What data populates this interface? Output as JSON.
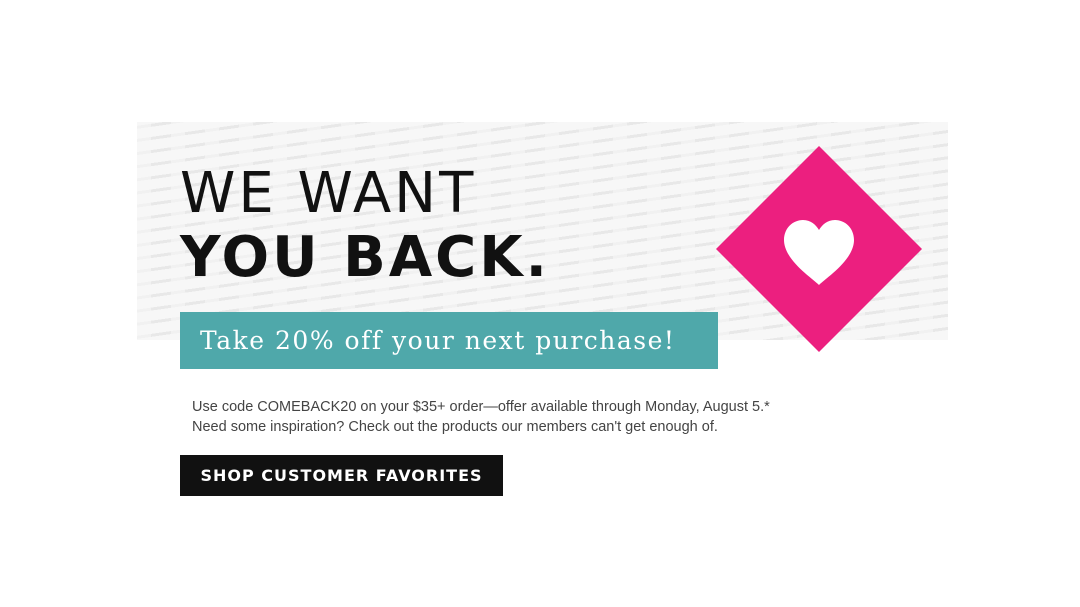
{
  "headline": {
    "line1": "WE WANT",
    "line2": "YOU BACK."
  },
  "offer": {
    "text": "Take 20% off your next purchase!"
  },
  "body": {
    "line1": "Use code COMEBACK20 on your $35+ order—offer available through Monday, August 5.*",
    "line2": "Need some inspiration? Check out the products our members can't get enough of."
  },
  "cta": {
    "label": "SHOP CUSTOMER FAVORITES"
  },
  "graphic": {
    "icon": "heart-icon",
    "shape": "diamond"
  },
  "colors": {
    "accent_pink": "#ec1f7f",
    "offer_teal": "#4fa8aa",
    "cta_black": "#111111",
    "text_dark": "#111111",
    "body_gray": "#444444"
  }
}
